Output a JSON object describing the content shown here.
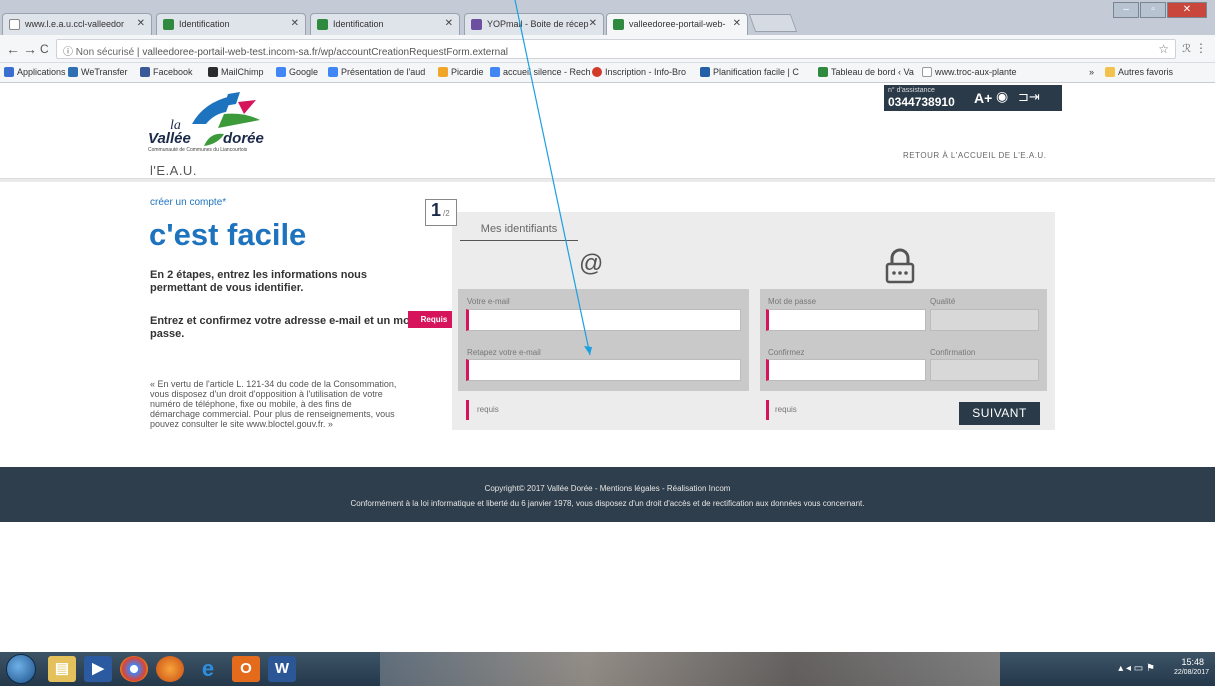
{
  "browser": {
    "tabs": [
      {
        "label": "www.l.e.a.u.ccl-valleedor",
        "color": "#5b86c5"
      },
      {
        "label": "Identification",
        "color": "#2f8a3f"
      },
      {
        "label": "Identification",
        "color": "#2f8a3f"
      },
      {
        "label": "YOPmail - Boite de récep",
        "color": "#6c4f9e"
      },
      {
        "label": "valleedoree-portail-web-",
        "color": "#2f8a3f"
      }
    ],
    "url_secure_label": "Non sécurisé",
    "url": "valleedoree-portail-web-test.incom-sa.fr/wp/accountCreationRequestForm.external",
    "bookmarks": [
      {
        "label": "Applications",
        "color": "#3a6fcf"
      },
      {
        "label": "WeTransfer",
        "color": "#2f6fb2"
      },
      {
        "label": "Facebook",
        "color": "#3b5998"
      },
      {
        "label": "MailChimp",
        "color": "#2b2b2b"
      },
      {
        "label": "Google",
        "color": "#4285f4"
      },
      {
        "label": "Présentation de l'aud",
        "color": "#4285f4"
      },
      {
        "label": "Picardie",
        "color": "#f1a62a"
      },
      {
        "label": "accueil silence - Rech",
        "color": "#4285f4"
      },
      {
        "label": "Inscription - Info-Bro",
        "color": "#d23a2a"
      },
      {
        "label": "Planification facile | C",
        "color": "#2460a7"
      },
      {
        "label": "Tableau de bord ‹ Va",
        "color": "#2f8a3f"
      },
      {
        "label": "www.troc-aux-plante",
        "color": "#9ba5b0"
      },
      {
        "label": "Autres favoris",
        "color": "#f2c14e"
      }
    ],
    "bookmark_overflow": "»"
  },
  "header": {
    "logo_la": "la",
    "logo_vallee": "Vallée",
    "logo_doree": "dorée",
    "logo_subtitle": "Communauté de Communes du Liancourtois",
    "site_name": "l'E.A.U.",
    "back_link": "RETOUR À L'ACCUEIL DE L'E.A.U.",
    "assist_label": "n° d'assistance",
    "assist_phone": "0344738910",
    "a11y_text_size": "A+"
  },
  "intro": {
    "kicker": "créer un compte*",
    "title": "c'est facile",
    "p1": "En 2 étapes, entrez les informations nous permettant de vous identifier.",
    "p2": "Entrez et confirmez votre adresse e-mail et un mot de passe.",
    "required_badge": "Requis",
    "legal": "« En vertu de l'article L. 121-34 du code de la Consommation, vous disposez d'un droit d'opposition à l'utilisation de votre numéro de téléphone, fixe ou mobile, à des fins de démarchage commercial. Pour plus de renseignements, vous pouvez consulter le site www.bloctel.gouv.fr. »"
  },
  "form": {
    "step_current": "1",
    "step_total": "/2",
    "tab_label": "Mes identifiants",
    "at_symbol": "@",
    "email_label": "Votre e-mail",
    "email_confirm_label": "Retapez votre e-mail",
    "password_label": "Mot de passe",
    "quality_label": "Qualité",
    "confirm_label": "Confirmez",
    "confirmation_label": "Confirmation",
    "legend_required": "requis",
    "next_button": "SUIVANT"
  },
  "footer": {
    "line1": "Copyright© 2017 Vallée Dorée  -  Mentions légales  -  Réalisation Incom",
    "line2": "Conformément à la loi informatique et liberté du 6 janvier 1978, vous disposez d'un droit d'accès et de rectification aux données vous concernant."
  },
  "taskbar": {
    "time": "15:48",
    "date": "22/08/2017"
  },
  "colors": {
    "brand_blue": "#1e73be",
    "required_pink": "#d5145c",
    "dark_navy": "#2f3e4c",
    "annotation_line": "#1aa0e0"
  }
}
